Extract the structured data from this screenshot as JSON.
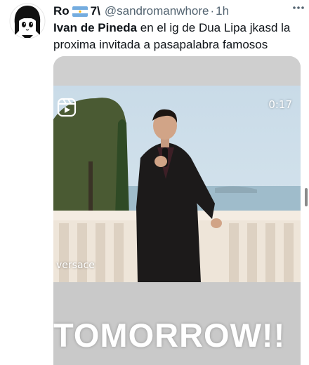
{
  "tweet": {
    "display_name": "Ro",
    "flag_icon": "argentina-flag-icon",
    "name_suffix": "7\\",
    "handle": "@sandromanwhore",
    "separator": "·",
    "time": "1h",
    "more_icon": "more-options-icon",
    "text_mention": "Ivan de Pineda",
    "text_rest": " en el ig de Dua Lipa jkasd la proxima invitada a pasapalabra famosos"
  },
  "media": {
    "reel_icon": "reels-icon",
    "timer": "0:17",
    "caption": "versace",
    "banner": "TOMORROW!!"
  },
  "colors": {
    "text": "#0f1419",
    "secondary": "#536471"
  }
}
